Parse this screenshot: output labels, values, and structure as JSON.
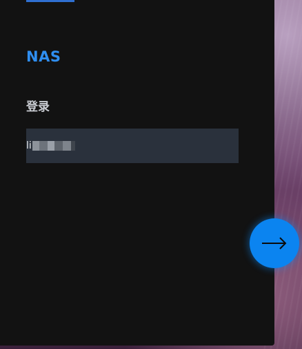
{
  "brand": {
    "name": "NAS"
  },
  "login": {
    "title": "登录",
    "account_value_visible": "li"
  },
  "next_button": {
    "icon": "arrow-right-icon"
  },
  "colors": {
    "panel_background": "#121212",
    "brand_text": "#2f8ef0",
    "input_background": "#2a313c",
    "next_button_fill": "#0b84f0",
    "top_accent": "#2f6fd1"
  }
}
